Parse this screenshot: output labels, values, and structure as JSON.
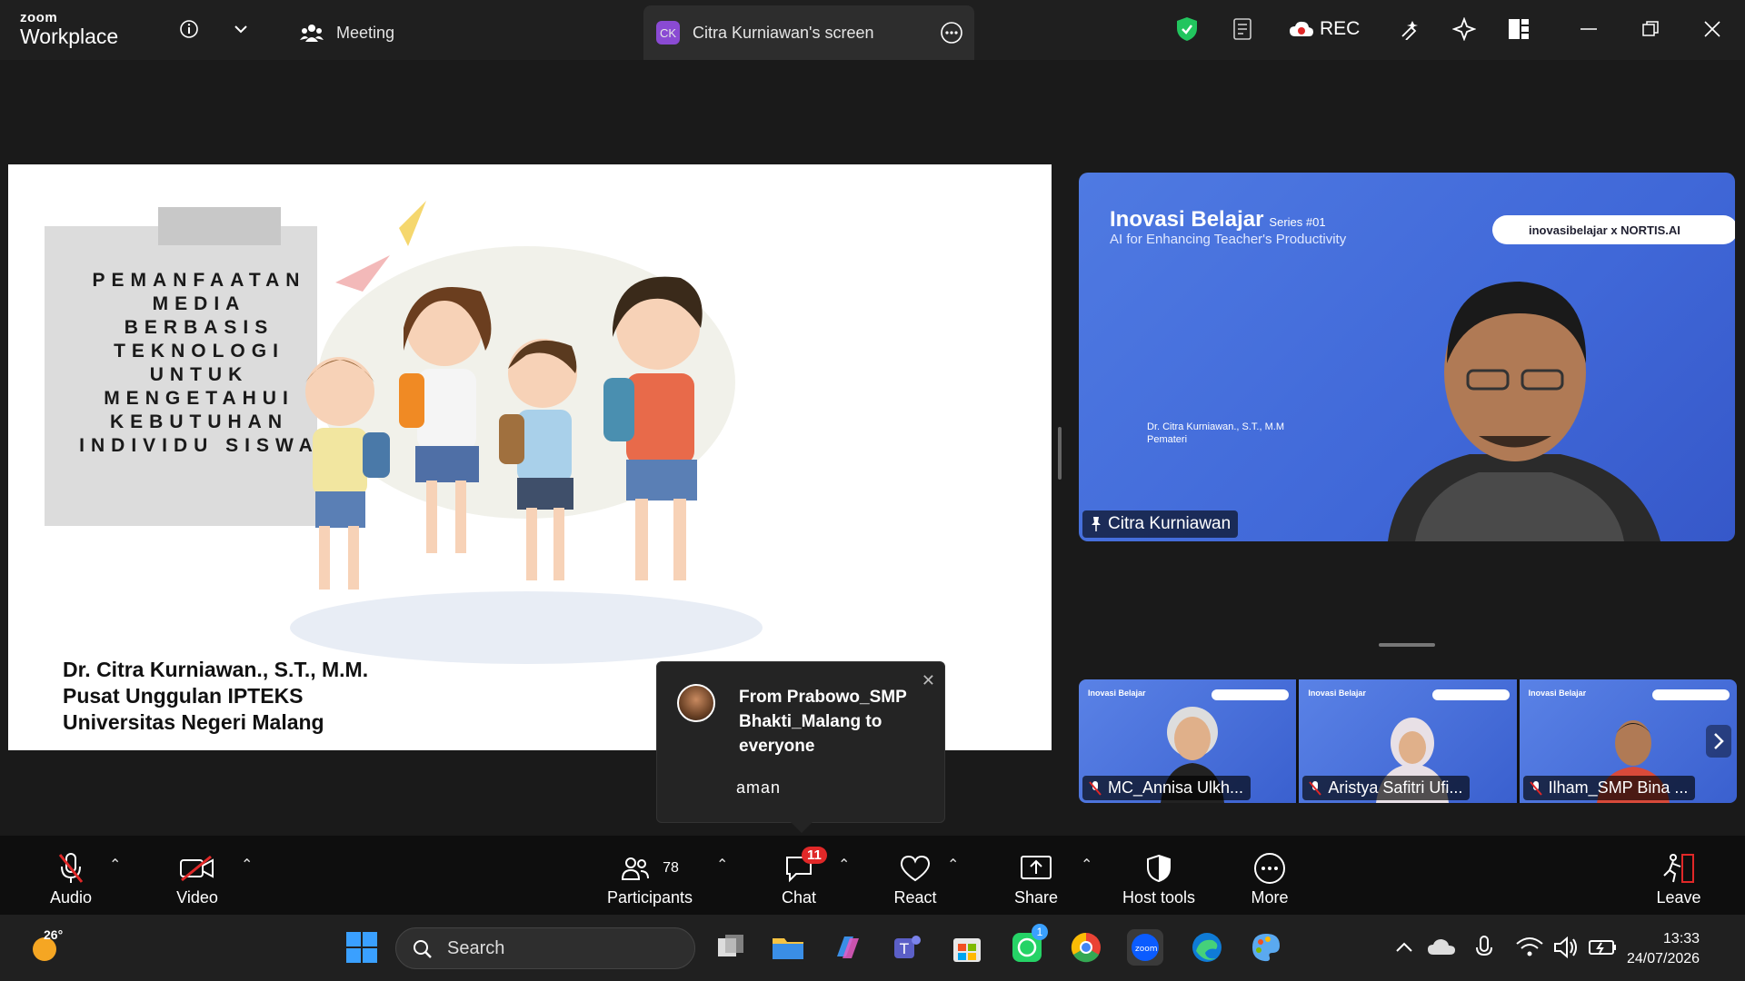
{
  "app": {
    "logo_top": "zoom",
    "logo_bottom": "Workplace",
    "tabs": [
      {
        "label": "Meeting"
      },
      {
        "label": "Citra Kurniawan's screen",
        "initials": "CK"
      }
    ],
    "rec_label": "REC"
  },
  "slide": {
    "title": "PEMANFAATAN\nMEDIA\nBERBASIS\nTEKNOLOGI\nUNTUK\nMENGETAHUI\nKEBUTUHAN\nINDIVIDU SISWA",
    "author_lines": [
      "Dr. Citra Kurniawan., S.T., M.M.",
      "Pusat Unggulan IPTEKS",
      "Universitas Negeri Malang"
    ]
  },
  "speaker": {
    "banner_title": "Inovasi Belajar",
    "banner_series": "Series #01",
    "banner_sub": "AI for Enhancing Teacher's Productivity",
    "badge_text": "inovasibelajar x NORTIS.AI",
    "caption_lines": [
      "Dr. Citra Kurniawan., S.T., M.M",
      "Pemateri"
    ],
    "name": "Citra Kurniawan"
  },
  "participants_strip": [
    {
      "name": "MC_Annisa Ulkh...",
      "thumb_title": "Inovasi Belajar"
    },
    {
      "name": "Aristya Safitri Ufi...",
      "thumb_title": "Inovasi Belajar"
    },
    {
      "name": "Ilham_SMP Bina ...",
      "thumb_title": "Inovasi Belajar"
    }
  ],
  "chat_popup": {
    "from": "From Prabowo_SMP Bhakti_Malang to everyone",
    "message": "aman"
  },
  "toolbar": {
    "audio": "Audio",
    "video": "Video",
    "participants": "Participants",
    "participants_count": "78",
    "chat": "Chat",
    "chat_badge": "11",
    "react": "React",
    "share": "Share",
    "host_tools": "Host tools",
    "more": "More",
    "leave": "Leave"
  },
  "taskbar": {
    "weather_temp": "26°",
    "search_placeholder": "Search",
    "whatsapp_badge": "1",
    "time": "13:33",
    "date": "24/07/2026"
  },
  "colors": {
    "accent_red": "#e02828",
    "shield_green": "#22c55e",
    "zoom_blue": "#0b5cff",
    "ck_purple": "#8a4ad3"
  }
}
